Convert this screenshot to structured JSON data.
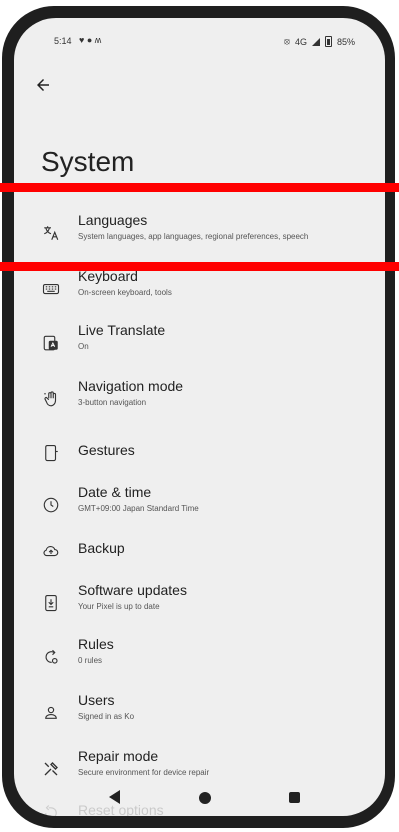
{
  "status_bar": {
    "time": "5:14",
    "left_icons": "♥ ● ʍ",
    "network": "4G",
    "battery": "85%"
  },
  "page": {
    "title": "System"
  },
  "items": [
    {
      "label": "Languages",
      "sub": "System languages, app languages, regional preferences, speech",
      "icon": "translate-icon"
    },
    {
      "label": "Keyboard",
      "sub": "On-screen keyboard, tools",
      "icon": "keyboard-icon"
    },
    {
      "label": "Live Translate",
      "sub": "On",
      "icon": "live-translate-icon"
    },
    {
      "label": "Navigation mode",
      "sub": "3-button navigation",
      "icon": "gesture-hand-icon"
    },
    {
      "label": "Gestures",
      "sub": "",
      "icon": "gestures-phone-icon"
    },
    {
      "label": "Date & time",
      "sub": "GMT+09:00 Japan Standard Time",
      "icon": "clock-icon"
    },
    {
      "label": "Backup",
      "sub": "",
      "icon": "cloud-upload-icon"
    },
    {
      "label": "Software updates",
      "sub": "Your Pixel is up to date",
      "icon": "system-update-icon"
    },
    {
      "label": "Rules",
      "sub": "0 rules",
      "icon": "rules-icon"
    },
    {
      "label": "Users",
      "sub": "Signed in as Ko",
      "icon": "user-icon"
    },
    {
      "label": "Repair mode",
      "sub": "Secure environment for device repair",
      "icon": "repair-tools-icon"
    },
    {
      "label": "Reset options",
      "sub": "",
      "icon": "reset-icon"
    }
  ]
}
